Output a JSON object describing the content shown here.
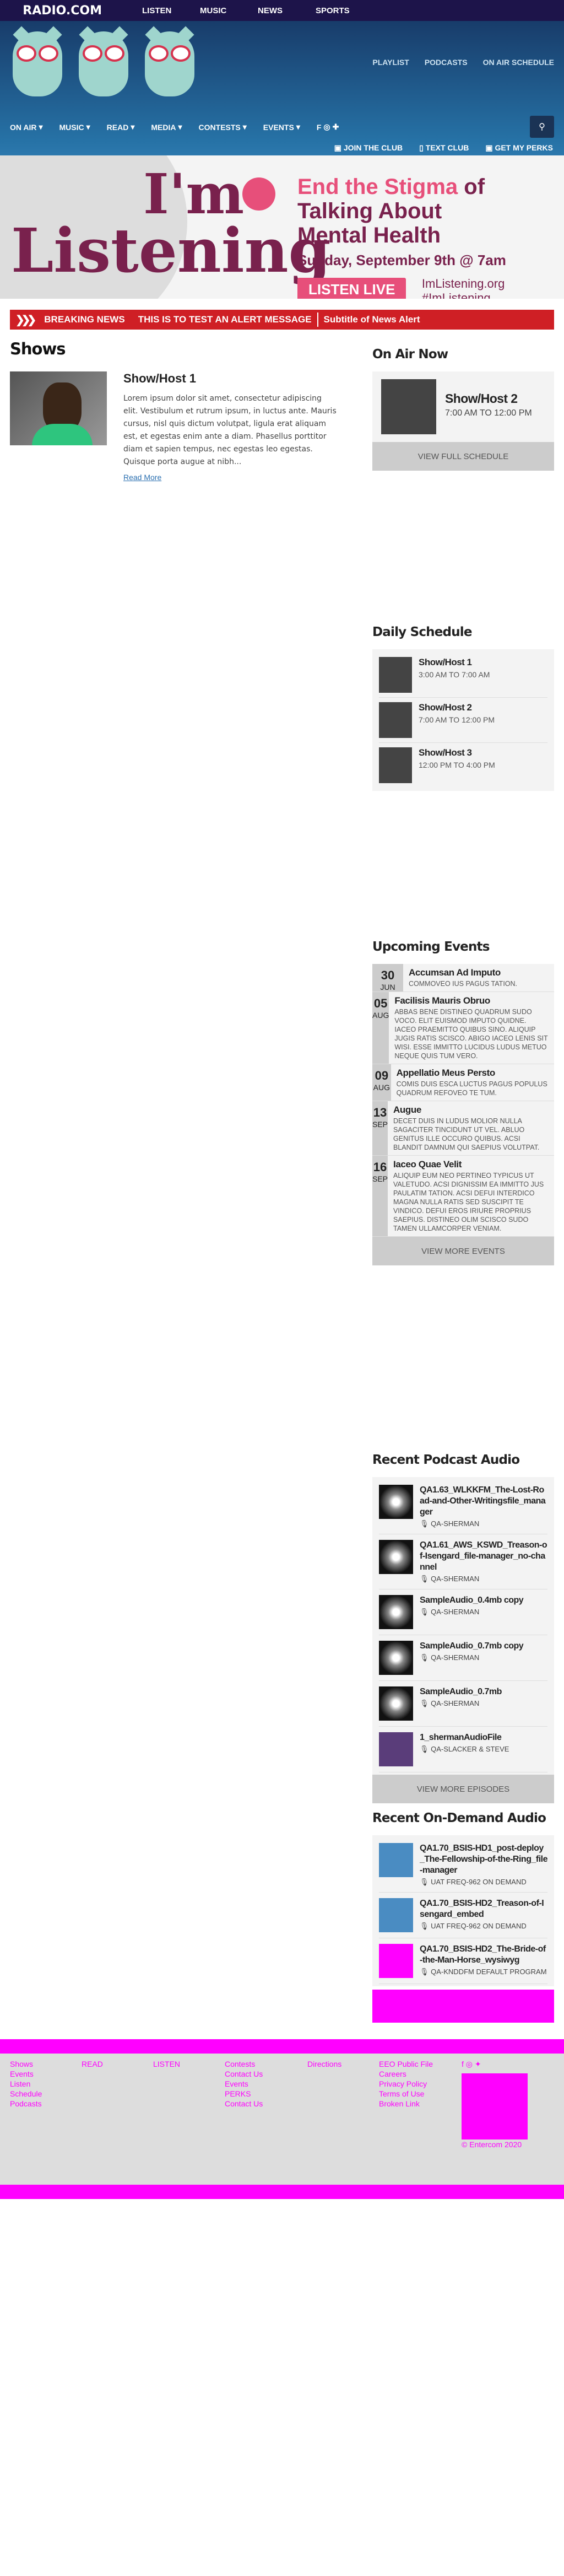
{
  "topbar": {
    "logo": "RADIO.COM",
    "logo_prefix": "",
    "nav": [
      "LISTEN",
      "MUSIC",
      "NEWS",
      "SPORTS"
    ]
  },
  "header": {
    "right_links": [
      "PLAYLIST",
      "PODCASTS",
      "ON AIR SCHEDULE"
    ],
    "main_nav": [
      "ON AIR",
      "MUSIC",
      "READ",
      "MEDIA",
      "CONTESTS",
      "EVENTS"
    ],
    "perks": [
      "JOIN THE CLUB",
      "TEXT CLUB",
      "GET MY PERKS"
    ]
  },
  "banner": {
    "im": "I'm",
    "listening": "Listening",
    "headline_part1": "End the Stigma",
    "headline_part2": "of Talking About",
    "headline_part3": "Mental Health",
    "date": "Sunday, September 9th @ 7am",
    "button": "LISTEN LIVE",
    "site": "ImListening.org",
    "hashtag": "#ImListening"
  },
  "alert": {
    "label": "BREAKING NEWS",
    "message": "THIS IS TO TEST AN ALERT MESSAGE",
    "subtitle": "Subtitle of News Alert"
  },
  "shows": {
    "heading": "Shows",
    "items": [
      {
        "title": "Show/Host 1",
        "body": "Lorem ipsum dolor sit amet, consectetur adipiscing elit. Vestibulum et rutrum ipsum, in luctus ante. Mauris cursus, nisl quis dictum volutpat, ligula erat aliquam est, et egestas enim ante a diam. Phasellus porttitor diam et sapien tempus, nec egestas leo egestas. Quisque porta augue at nibh...",
        "more": "Read More"
      }
    ]
  },
  "on_air": {
    "heading": "On Air Now",
    "host": "Show/Host 2",
    "time": "7:00 AM TO 12:00 PM",
    "button": "VIEW FULL SCHEDULE"
  },
  "daily": {
    "heading": "Daily Schedule",
    "items": [
      {
        "name": "Show/Host 1",
        "time": "3:00 AM TO 7:00 AM"
      },
      {
        "name": "Show/Host 2",
        "time": "7:00 AM TO 12:00 PM"
      },
      {
        "name": "Show/Host 3",
        "time": "12:00 PM TO 4:00 PM"
      }
    ]
  },
  "events": {
    "heading": "Upcoming Events",
    "items": [
      {
        "day": "30",
        "month": "JUN",
        "title": "Accumsan Ad Imputo",
        "desc": "COMMOVEO IUS PAGUS TATION."
      },
      {
        "day": "05",
        "month": "AUG",
        "title": "Facilisis Mauris Obruo",
        "desc": "ABBAS BENE DISTINEO QUADRUM SUDO VOCO. ELIT EUISMOD IMPUTO QUIDNE. IACEO PRAEMITTO QUIBUS SINO. ALIQUIP JUGIS RATIS SCISCO. ABIGO IACEO LENIS SIT WISI. ESSE IMMITTO LUCIDUS LUDUS METUO NEQUE QUIS TUM VERO."
      },
      {
        "day": "09",
        "month": "AUG",
        "title": "Appellatio Meus Persto",
        "desc": "COMIS DUIS ESCA LUCTUS PAGUS POPULUS QUADRUM REFOVEO TE TUM."
      },
      {
        "day": "13",
        "month": "SEP",
        "title": "Augue",
        "desc": "DECET DUIS IN LUDUS MOLIOR NULLA SAGACITER TINCIDUNT UT VEL. ABLUO GENITUS ILLE OCCURO QUIBUS. ACSI BLANDIT DAMNUM QUI SAEPIUS VOLUTPAT."
      },
      {
        "day": "16",
        "month": "SEP",
        "title": "Iaceo Quae Velit",
        "desc": "ALIQUIP EUM NEO PERTINEO TYPICUS UT VALETUDO. ACSI DIGNISSIM EA IMMITTO JUS PAULATIM TATION. ACSI DEFUI INTERDICO MAGNA NULLA RATIS SED SUSCIPIT TE VINDICO. DEFUI EROS IRIURE PROPRIUS SAEPIUS. DISTINEO OLIM SCISCO SUDO TAMEN ULLAMCORPER VENIAM."
      }
    ],
    "button": "VIEW MORE EVENTS"
  },
  "podcasts": {
    "heading": "Recent Podcast Audio",
    "items": [
      {
        "title": "QA1.63_WLKKFM_The-Lost-Road-and-Other-Writingsfile_manager",
        "by": "QA-SHERMAN"
      },
      {
        "title": "QA1.61_AWS_KSWD_Treason-of-Isengard_file-manager_no-channel",
        "by": "QA-SHERMAN"
      },
      {
        "title": "SampleAudio_0.4mb copy",
        "by": "QA-SHERMAN"
      },
      {
        "title": "SampleAudio_0.7mb copy",
        "by": "QA-SHERMAN"
      },
      {
        "title": "SampleAudio_0.7mb",
        "by": "QA-SHERMAN"
      },
      {
        "title": "1_shermanAudioFile",
        "by": "QA-SLACKER & STEVE"
      }
    ],
    "button": "VIEW MORE EPISODES"
  },
  "ondemand": {
    "heading": "Recent On-Demand Audio",
    "items": [
      {
        "title": "QA1.70_BSIS-HD1_post-deploy_The-Fellowship-of-the-Ring_file-manager",
        "by": "UAT FREQ-962 ON DEMAND"
      },
      {
        "title": "QA1.70_BSIS-HD2_Treason-of-Isengard_embed",
        "by": "UAT FREQ-962 ON DEMAND"
      },
      {
        "title": "QA1.70_BSIS-HD2_The-Bride-of-the-Man-Horse_wysiwyg",
        "by": "QA-KNDDFM DEFAULT PROGRAM"
      }
    ]
  },
  "footer": {
    "cols": [
      [
        "Shows",
        "Events",
        "Listen",
        "Schedule",
        "Podcasts"
      ],
      [
        "READ"
      ],
      [
        "LISTEN"
      ],
      [
        "Contests",
        "Contact Us",
        "Events",
        "PERKS",
        "Contact Us"
      ],
      [
        "Directions"
      ],
      [
        "EEO Public File",
        "Careers",
        "Privacy Policy",
        "Terms of Use",
        "Broken Link"
      ]
    ],
    "copyright": "© Entercom 2020"
  }
}
